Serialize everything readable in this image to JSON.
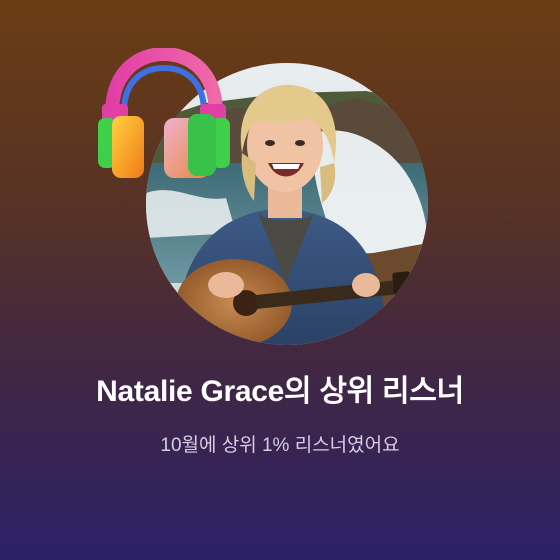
{
  "card": {
    "title": "Natalie Grace의 상위 리스너",
    "subtitle": "10월에 상위 1% 리스너였어요",
    "avatar_icon": "artist-photo",
    "badge_icon": "headphones-icon",
    "gradient_top": "#6b3d14",
    "gradient_bottom": "#2c2068"
  }
}
